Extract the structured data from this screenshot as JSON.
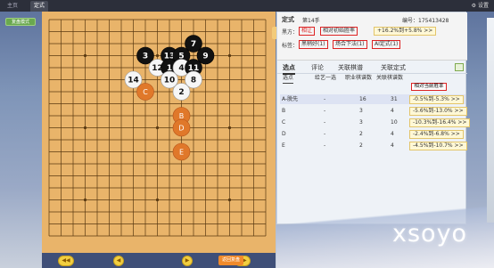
{
  "window": {
    "tabs": [
      "主页",
      "定式"
    ],
    "settings_label": "设置"
  },
  "left": {
    "top_button": "复盘模式"
  },
  "board": {
    "grid_lines": 19,
    "stones": [
      {
        "col": 12,
        "row": 2,
        "color": "black",
        "num": "7"
      },
      {
        "col": 8,
        "row": 3,
        "color": "black",
        "num": "3"
      },
      {
        "col": 10,
        "row": 3,
        "color": "black",
        "num": "13"
      },
      {
        "col": 11,
        "row": 3,
        "color": "black",
        "num": "5"
      },
      {
        "col": 13,
        "row": 3,
        "color": "black",
        "num": "9"
      },
      {
        "col": 9,
        "row": 4,
        "color": "white",
        "num": "12"
      },
      {
        "col": 10,
        "row": 4,
        "color": "black",
        "num": "1"
      },
      {
        "col": 11,
        "row": 4,
        "color": "white",
        "num": "4"
      },
      {
        "col": 12,
        "row": 4,
        "color": "black",
        "num": "11"
      },
      {
        "col": 7,
        "row": 5,
        "color": "white",
        "num": "14"
      },
      {
        "col": 10,
        "row": 5,
        "color": "white",
        "num": "10"
      },
      {
        "col": 12,
        "row": 5,
        "color": "white",
        "num": "8"
      },
      {
        "col": 11,
        "row": 6,
        "color": "white",
        "num": "2"
      }
    ],
    "candidates": [
      {
        "col": 8,
        "row": 6,
        "label": "C"
      },
      {
        "col": 11,
        "row": 8,
        "label": "B"
      },
      {
        "col": 11,
        "row": 9,
        "label": "D"
      },
      {
        "col": 11,
        "row": 11,
        "label": "E"
      }
    ],
    "colors": {
      "wood": "#e9b46a",
      "line": "#5a3a12",
      "orange": "#e0782a"
    }
  },
  "nav": {
    "first": "◀◀",
    "prev": "◀",
    "next": "▶",
    "last": "▶▶",
    "review": "返回复盘"
  },
  "panel": {
    "title": "定式",
    "move": "第14手",
    "id_label": "编号：175413428",
    "row2_label": "黑方：",
    "row2_side": "相让",
    "row2_rate_label": "相对初始胜率",
    "row2_pill": "+16.2%到+5.8% >>",
    "tags_label": "标签：",
    "tags": [
      "黑稍好(1)",
      "场合下法(1)",
      "AI定式(1)"
    ],
    "tabs": [
      "选点",
      "评论",
      "关联棋谱",
      "关联定式"
    ],
    "subtabs": [
      "选点",
      "给艺一选",
      "职业棋谱数",
      "关联棋谱数"
    ],
    "rate_header": "相对当前胜率",
    "rows": [
      {
        "point": "A-脱先",
        "col2": "-",
        "pro": "16",
        "rel": "31",
        "rate": "-0.5%到-5.3% >>"
      },
      {
        "point": "B",
        "col2": "-",
        "pro": "3",
        "rel": "4",
        "rate": "-5.6%到-13.0% >>"
      },
      {
        "point": "C",
        "col2": "-",
        "pro": "3",
        "rel": "10",
        "rate": "-10.3%到-16.4% >>"
      },
      {
        "point": "D",
        "col2": "-",
        "pro": "2",
        "rel": "4",
        "rate": "-2.4%到-6.8% >>"
      },
      {
        "point": "E",
        "col2": "-",
        "pro": "2",
        "rel": "4",
        "rate": "-4.5%到-10.7% >>"
      }
    ]
  },
  "brand": "xsoyo"
}
